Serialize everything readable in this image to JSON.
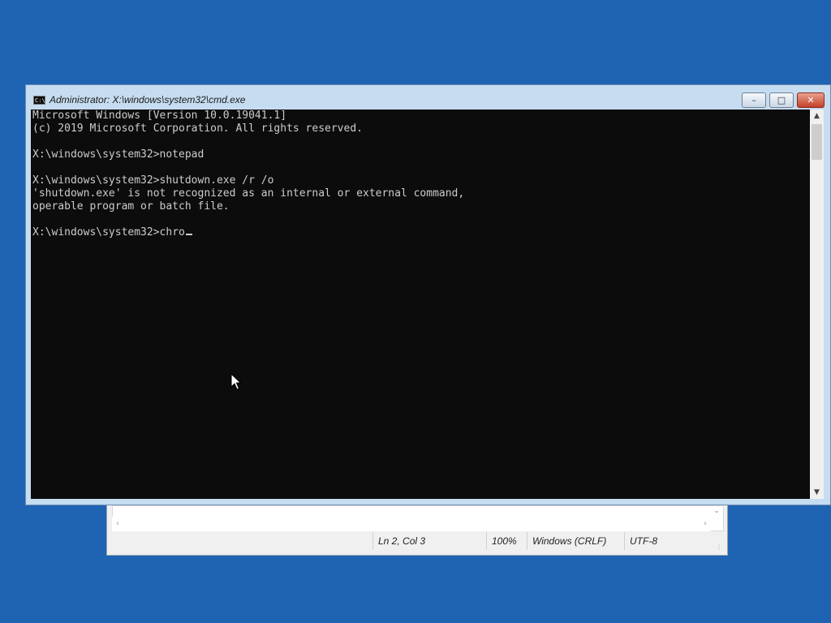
{
  "notepad": {
    "status": {
      "position": "Ln 2, Col 3",
      "zoom": "100%",
      "line_ending": "Windows (CRLF)",
      "encoding": "UTF-8"
    }
  },
  "cmd": {
    "title": "Administrator: X:\\windows\\system32\\cmd.exe",
    "icon_label": "C:\\",
    "buttons": {
      "minimize": "–",
      "maximize": "□",
      "close": "✕"
    },
    "lines": [
      "Microsoft Windows [Version 10.0.19041.1]",
      "(c) 2019 Microsoft Corporation. All rights reserved.",
      "",
      "X:\\windows\\system32>notepad",
      "",
      "X:\\windows\\system32>shutdown.exe /r /o",
      "'shutdown.exe' is not recognized as an internal or external command,",
      "operable program or batch file.",
      ""
    ],
    "prompt": "X:\\windows\\system32>",
    "input": "chro"
  },
  "icons": {
    "console": "console-icon",
    "pointer": "mouse-pointer-icon",
    "scroll_up": "chevron-up-icon",
    "scroll_down": "chevron-down-icon"
  }
}
